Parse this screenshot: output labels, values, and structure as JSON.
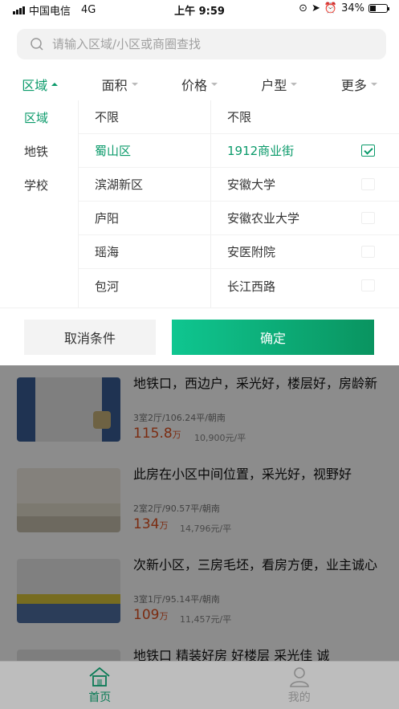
{
  "status": {
    "carrier": "中国电信",
    "network": "4G",
    "time": "上午 9:59",
    "battery": "34%",
    "battery_level": 0.34
  },
  "search": {
    "placeholder": "请输入区域/小区或商圈查找"
  },
  "filters": [
    {
      "label": "区域",
      "active": true
    },
    {
      "label": "面积",
      "active": false
    },
    {
      "label": "价格",
      "active": false
    },
    {
      "label": "户型",
      "active": false
    },
    {
      "label": "更多",
      "active": false
    }
  ],
  "dropdown": {
    "types": [
      "区域",
      "地铁",
      "学校"
    ],
    "districts": [
      "不限",
      "蜀山区",
      "滨湖新区",
      "庐阳",
      "瑶海",
      "包河"
    ],
    "areas": [
      "不限",
      "1912商业街",
      "安徽大学",
      "安徽农业大学",
      "安医附院",
      "长江西路"
    ],
    "cancel_label": "取消条件",
    "confirm_label": "确定"
  },
  "listings": [
    {
      "title": "地铁口，西边户，采光好，楼层好，房龄新",
      "meta": "3室2厅/106.24平/朝南",
      "price": "115.8",
      "price_unit": "万",
      "unit_price": "10,900元/平"
    },
    {
      "title": "此房在小区中间位置，采光好，视野好",
      "meta": "2室2厅/90.57平/朝南",
      "price": "134",
      "price_unit": "万",
      "unit_price": "14,796元/平"
    },
    {
      "title": "次新小区，三房毛坯，看房方便，业主诚心",
      "meta": "3室1厅/95.14平/朝南",
      "price": "109",
      "price_unit": "万",
      "unit_price": "11,457元/平"
    },
    {
      "title": "地铁口 精装好房 好楼层 采光佳 诚",
      "meta": "",
      "price": "",
      "price_unit": "",
      "unit_price": ""
    }
  ],
  "bottom_nav": [
    {
      "label": "首页",
      "icon": "home-icon"
    },
    {
      "label": "我的",
      "icon": "user-icon"
    }
  ],
  "colors": {
    "accent": "#0a9a6a",
    "price": "#e05020"
  }
}
